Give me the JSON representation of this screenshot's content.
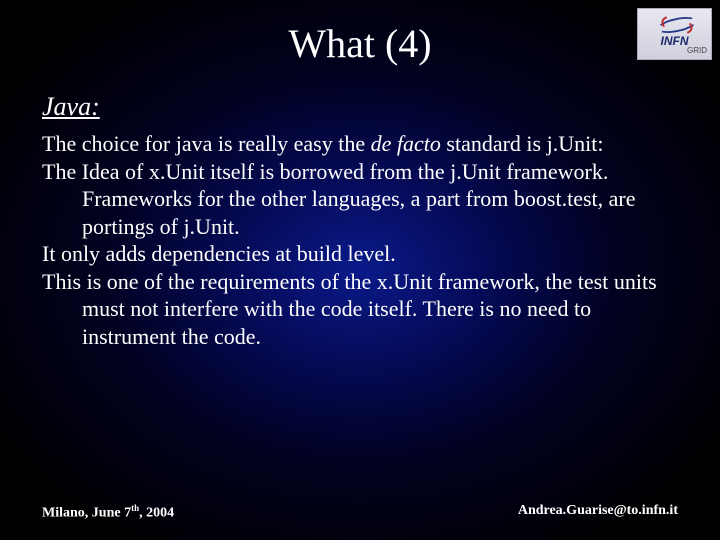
{
  "logo": {
    "line1": "INFN",
    "line2": "GRID"
  },
  "title": "What (4)",
  "section": "Java:",
  "body": {
    "p1a": "The choice for java is really easy the ",
    "p1b": "de facto",
    "p1c": " standard is j.Unit:",
    "p2": "The Idea of x.Unit itself is borrowed from the j.Unit framework. Frameworks for the other languages, a part from boost.test, are portings of  j.Unit.",
    "p3": "It only adds dependencies at build level.",
    "p4": "This is one of the requirements of the x.Unit framework, the test units must not interfere with the code itself. There is no need to instrument the code."
  },
  "footer": {
    "left_a": "Milano, June 7",
    "left_b": "th",
    "left_c": ", 2004",
    "right": "Andrea.Guarise@to.infn.it"
  }
}
